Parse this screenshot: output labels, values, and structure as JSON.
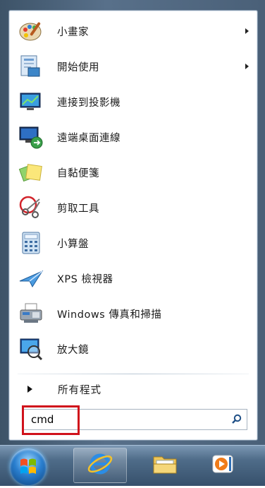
{
  "start_menu": {
    "programs": [
      {
        "label": "小畫家",
        "icon": "paint-icon",
        "has_submenu": true
      },
      {
        "label": "開始使用",
        "icon": "getting-started-icon",
        "has_submenu": true
      },
      {
        "label": "連接到投影機",
        "icon": "projector-icon",
        "has_submenu": false
      },
      {
        "label": "遠端桌面連線",
        "icon": "remote-desktop-icon",
        "has_submenu": false
      },
      {
        "label": "自黏便箋",
        "icon": "sticky-notes-icon",
        "has_submenu": false
      },
      {
        "label": "剪取工具",
        "icon": "snipping-tool-icon",
        "has_submenu": false
      },
      {
        "label": "小算盤",
        "icon": "calculator-icon",
        "has_submenu": false
      },
      {
        "label": "XPS 檢視器",
        "icon": "xps-viewer-icon",
        "has_submenu": false
      },
      {
        "label": "Windows 傳真和掃描",
        "icon": "fax-scan-icon",
        "has_submenu": false
      },
      {
        "label": "放大鏡",
        "icon": "magnifier-icon",
        "has_submenu": false
      }
    ],
    "all_programs_label": "所有程式",
    "search": {
      "value": "cmd",
      "placeholder": ""
    }
  },
  "taskbar": {
    "items": [
      {
        "icon": "start-orb-icon"
      },
      {
        "icon": "internet-explorer-icon"
      },
      {
        "icon": "file-explorer-icon"
      },
      {
        "icon": "media-player-icon"
      }
    ]
  },
  "colors": {
    "highlight": "#d0121b",
    "taskbar": "#4f6c89"
  }
}
